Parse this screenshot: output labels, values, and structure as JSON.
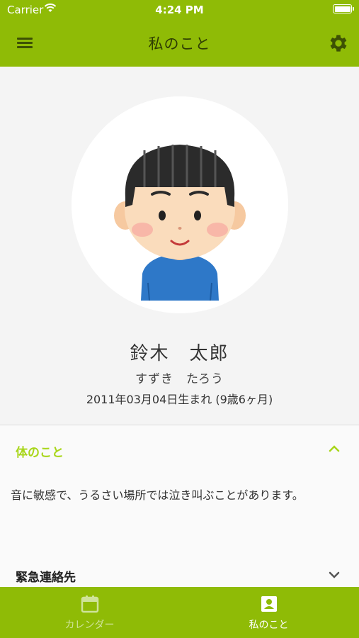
{
  "status_bar": {
    "carrier": "Carrier",
    "time": "4:24 PM"
  },
  "header": {
    "title": "私のこと",
    "menu_icon": "hamburger-icon",
    "settings_icon": "gear-icon"
  },
  "profile": {
    "name": "鈴木　太郎",
    "kana": "すずき　たろう",
    "birth": "2011年03月04日生まれ (9歳6ヶ月)"
  },
  "sections": [
    {
      "title": "体のこと",
      "expanded": true,
      "body": "音に敏感で、うるさい場所では泣き叫ぶことがあります。"
    },
    {
      "title": "緊急連絡先",
      "expanded": false
    }
  ],
  "tabs": [
    {
      "label": "カレンダー",
      "icon": "calendar-icon",
      "active": false
    },
    {
      "label": "私のこと",
      "icon": "contact-card-icon",
      "active": true
    }
  ],
  "colors": {
    "brand": "#8fbb06",
    "accent_text": "#a8d61a",
    "active_tab": "#ffffff",
    "inactive_tab": "#cfe39a"
  }
}
